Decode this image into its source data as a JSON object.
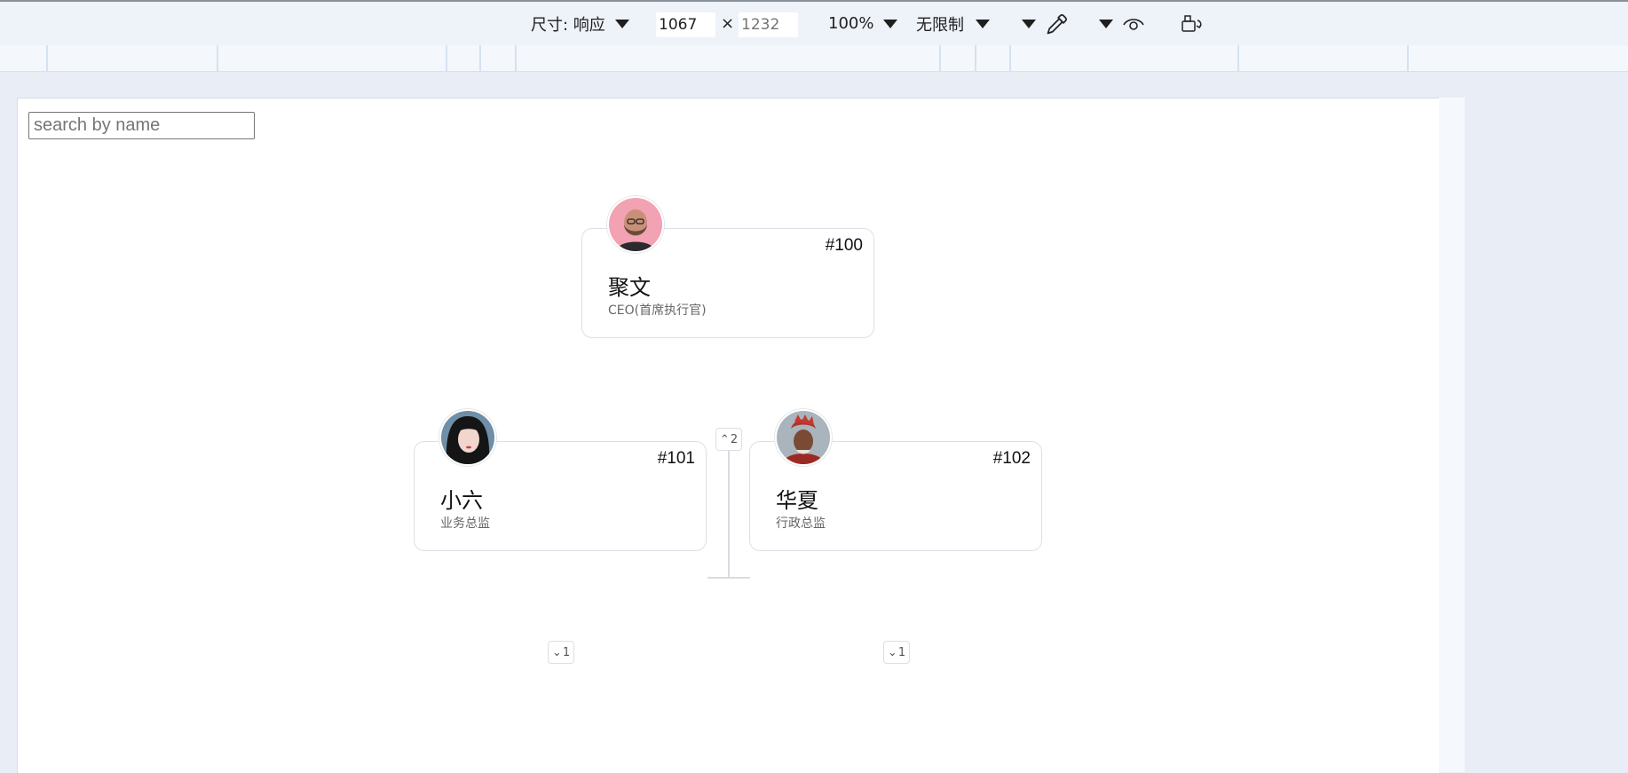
{
  "toolbar": {
    "size_label": "尺寸: 响应",
    "width_value": "1067",
    "times": "×",
    "height_placeholder": "1232",
    "zoom": "100%",
    "throttle": "无限制",
    "icons": [
      "eyedropper-icon",
      "eye-icon",
      "rotate-icon"
    ]
  },
  "search": {
    "placeholder": "search by name",
    "value": ""
  },
  "org": {
    "root": {
      "num": "#100",
      "name": "聚文",
      "role": "CEO(首席执行官)",
      "toggle_glyph": "⌃",
      "toggle_count": "2"
    },
    "children": [
      {
        "num": "#101",
        "name": "小六",
        "role": "业务总监",
        "toggle_glyph": "⌄",
        "toggle_count": "1"
      },
      {
        "num": "#102",
        "name": "华夏",
        "role": "行政总监",
        "toggle_glyph": "⌄",
        "toggle_count": "1"
      }
    ]
  }
}
